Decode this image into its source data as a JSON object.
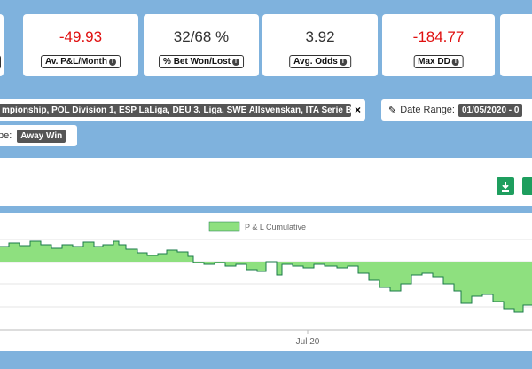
{
  "stats": [
    {
      "value": "-49.93",
      "label": "Av. P&L/Month",
      "negative": true
    },
    {
      "value": "32/68 %",
      "label": "% Bet Won/Lost",
      "negative": false
    },
    {
      "value": "3.92",
      "label": "Avg. Odds",
      "negative": false
    },
    {
      "value": "-184.77",
      "label": "Max DD",
      "negative": true
    }
  ],
  "filters": {
    "leagues": "mpionship, POL Division 1, ESP LaLiga, DEU 3. Liga, SWE Allsvenskan, ITA Serie B ...",
    "close": "×",
    "date_label": "Date Range:",
    "date_value": "01/05/2020 - 0",
    "type_label": "pe:",
    "type_value": "Away Win"
  },
  "chart": {
    "legend": "P & L Cumulative",
    "x_tick": "Jul 20",
    "fill_color": "#8ee07f",
    "line_color": "#1a7a4a"
  }
}
